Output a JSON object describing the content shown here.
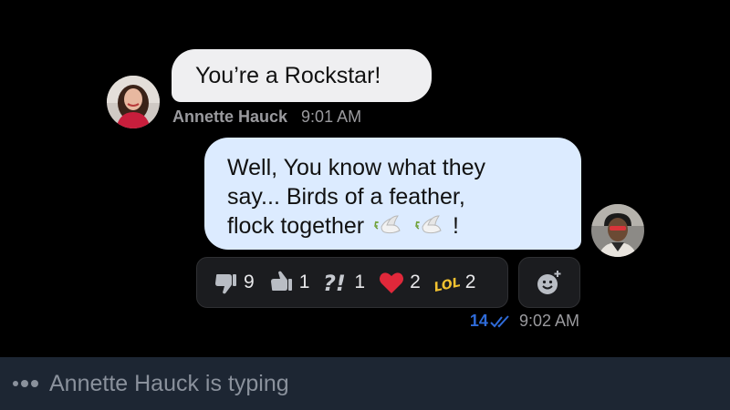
{
  "incoming": {
    "text": "You’re a Rockstar!",
    "sender": "Annette Hauck",
    "time": "9:01 AM"
  },
  "outgoing": {
    "line1": "Well, You know what they",
    "line2": "say... Birds of a feather,",
    "line3_start": "flock together",
    "line3_end": "!",
    "emoji_icons": [
      "dove-icon",
      "dove-icon"
    ],
    "read_count": "14",
    "time": "9:02 AM"
  },
  "reactions": [
    {
      "icon": "thumbs-down-icon",
      "count": "9"
    },
    {
      "icon": "thumbs-up-icon",
      "count": "1"
    },
    {
      "icon": "interrobang-icon",
      "count": "1"
    },
    {
      "icon": "heart-icon",
      "count": "2"
    },
    {
      "icon": "lol-icon",
      "count": "2"
    }
  ],
  "add_reaction": {
    "icon": "add-emoji-icon"
  },
  "typing": {
    "text": "Annette Hauck is typing"
  },
  "colors": {
    "background": "#000000",
    "incoming_bubble": "#efeff1",
    "outgoing_bubble": "#dcebff",
    "reaction_bar": "#1b1c1f",
    "typing_bar": "#1d2633",
    "read_receipt": "#2f6bd8",
    "heart": "#e0283a",
    "lol": "#f2c230"
  }
}
